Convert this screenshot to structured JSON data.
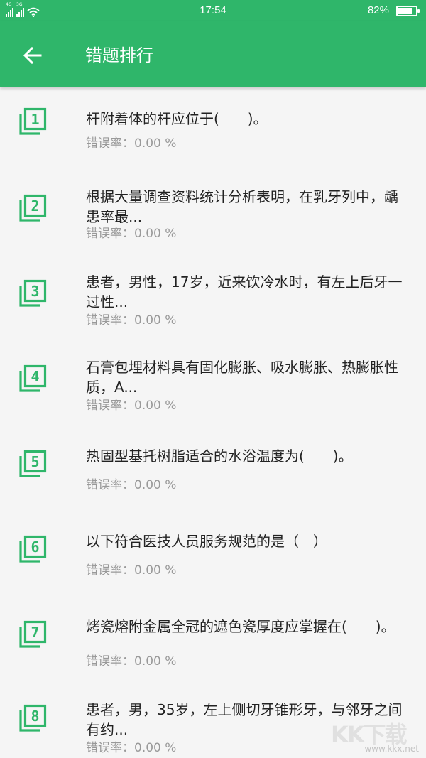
{
  "status_bar": {
    "network_1": "4G",
    "network_2": "3G",
    "time": "17:54",
    "battery_text": "82%",
    "battery_level": 0.82
  },
  "header": {
    "title": "错题排行",
    "back_icon": "arrow-left-icon"
  },
  "colors": {
    "brand_green": "#2fb66a",
    "text_primary": "#222222",
    "text_secondary": "#999999"
  },
  "items": [
    {
      "rank": "1",
      "question": "杆附着体的杆应位于(　　)。",
      "error_label": "错误率：",
      "error_rate": "0.00 %"
    },
    {
      "rank": "2",
      "question": "根据大量调查资料统计分析表明，在乳牙列中，龋患率最...",
      "error_label": "错误率：",
      "error_rate": "0.00 %"
    },
    {
      "rank": "3",
      "question": "患者，男性，17岁，近来饮冷水时，有左上后牙一过性...",
      "error_label": "错误率：",
      "error_rate": "0.00 %"
    },
    {
      "rank": "4",
      "question": "石膏包埋材料具有固化膨胀、吸水膨胀、热膨胀性质，A...",
      "error_label": "错误率：",
      "error_rate": "0.00 %"
    },
    {
      "rank": "5",
      "question": "热固型基托树脂适合的水浴温度为(　　)。",
      "error_label": "错误率：",
      "error_rate": "0.00 %"
    },
    {
      "rank": "6",
      "question": "以下符合医技人员服务规范的是（　）",
      "error_label": "错误率：",
      "error_rate": "0.00 %"
    },
    {
      "rank": "7",
      "question": "烤瓷熔附金属全冠的遮色瓷厚度应掌握在(　　)。",
      "error_label": "错误率：",
      "error_rate": "0.00 %"
    },
    {
      "rank": "8",
      "question": "患者，男，35岁，左上侧切牙锥形牙，与邻牙之间有约...",
      "error_label": "错误率：",
      "error_rate": "0.00 %"
    }
  ],
  "watermark": {
    "brand": "KK下载",
    "url": "www.kkx.net"
  }
}
